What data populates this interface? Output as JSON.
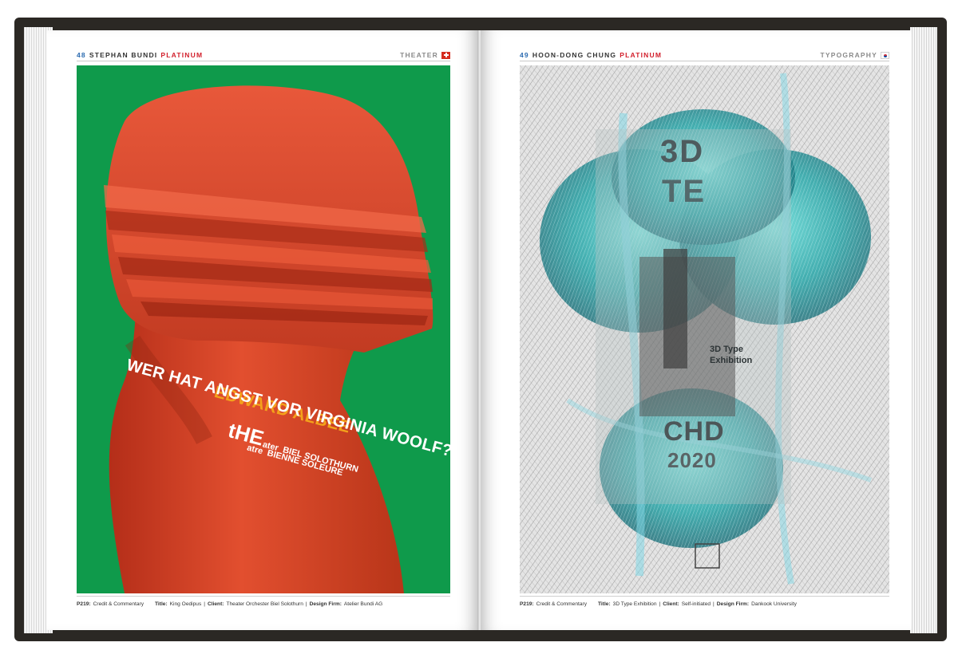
{
  "left_page": {
    "page_number": "48",
    "designer": "STEPHAN BUNDI",
    "award": "PLATINUM",
    "category": "THEATER",
    "flag_icon": "swiss-flag-icon",
    "poster": {
      "background": "#0f9a4b",
      "figure_color": "#d7452a",
      "author": "EDWARD ALBEE",
      "title": "WER HAT ANGST VOR VIRGINIA WOOLF?",
      "theater_line1_big": "tHE",
      "theater_line1_small": "ater",
      "theater_line2_big": "",
      "theater_line2_small": "atre",
      "city1": "BIEL SOLOTHURN",
      "city2": "BIENNE SOLEURE"
    },
    "footer": {
      "ref": "P219:",
      "ref_label": "Credit & Commentary",
      "title_label": "Title:",
      "title_value": "King Oedipus",
      "client_label": "Client:",
      "client_value": "Theater Orchester Biel Solothurn",
      "firm_label": "Design Firm:",
      "firm_value": "Atelier Bundi AG"
    }
  },
  "right_page": {
    "page_number": "49",
    "designer": "HOON-DONG CHUNG",
    "award": "PLATINUM",
    "category": "TYPOGRAPHY",
    "flag_icon": "korean-flag-icon",
    "poster": {
      "background": "#eaeaea",
      "accent": "#2aa8a8",
      "top_text": "3D",
      "middle_text": "TE",
      "bottom_text": "CHD",
      "year": "2020",
      "side_text1": "3D Type",
      "side_text2": "Exhibition"
    },
    "footer": {
      "ref": "P219:",
      "ref_label": "Credit & Commentary",
      "title_label": "Title:",
      "title_value": "3D Type Exhibition",
      "client_label": "Client:",
      "client_value": "Self-initiated",
      "firm_label": "Design Firm:",
      "firm_value": "Dankook University"
    }
  }
}
